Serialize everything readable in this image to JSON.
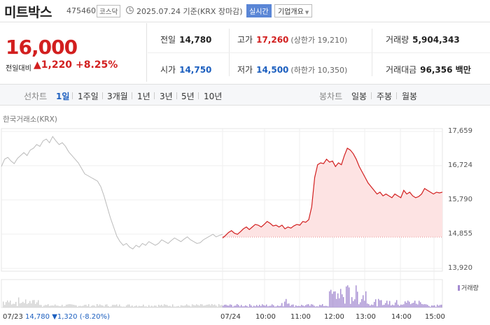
{
  "header": {
    "stock_name": "미트박스",
    "stock_code": "475460",
    "market_badge": "코스닥",
    "basis": "2025.07.24  기준(KRX 장마감)",
    "realtime_button": "실시간",
    "overview_button": "기업개요"
  },
  "price": {
    "current": "16,000",
    "diff_label": "전일대비",
    "diff_value": "▲1,220",
    "diff_percent": "+8.25%"
  },
  "stats": {
    "prev_close": {
      "label": "전일",
      "value": "14,780"
    },
    "high": {
      "label": "고가",
      "value": "17,260",
      "sub": "(상한가 19,210)"
    },
    "volume": {
      "label": "거래량",
      "value": "5,904,343"
    },
    "open": {
      "label": "시가",
      "value": "14,750"
    },
    "low": {
      "label": "저가",
      "value": "14,500",
      "sub": "(하한가 10,350)"
    },
    "trade_value": {
      "label": "거래대금",
      "value": "96,356 백만"
    }
  },
  "tabs": {
    "line_label": "선차트",
    "line_tabs": [
      "1일",
      "1주일",
      "3개월",
      "1년",
      "3년",
      "5년",
      "10년"
    ],
    "active_tab": "1일",
    "candle_label": "봉차트",
    "candle_tabs": [
      "일봉",
      "주봉",
      "월봉"
    ]
  },
  "chart_source": "한국거래소(KRX)",
  "chart_data": {
    "type": "line",
    "y_ticks": [
      "17,659",
      "16,724",
      "15,790",
      "14,855",
      "13,920"
    ],
    "ylim": [
      13920,
      17659
    ],
    "prev_close_line": 14780,
    "x_ticks": [
      "07/24",
      "10:00",
      "11:00",
      "12:00",
      "13:00",
      "14:00",
      "15:00"
    ],
    "prev_day_label": "07/23",
    "prev_day_info": {
      "price": "14,780",
      "change": "▼1,320",
      "percent": "(-8.20%)"
    },
    "volume_legend": "거래량",
    "series": [
      {
        "color": "#bbbbbb",
        "values": [
          16700,
          16900,
          16950,
          16850,
          16780,
          16920,
          17000,
          17080,
          17000,
          17150,
          17200,
          17300,
          17250,
          17400,
          17450,
          17350,
          17520,
          17400,
          17300,
          17350,
          17250,
          17100,
          17000,
          16900,
          16800,
          16650,
          16500,
          16450,
          16400,
          16350,
          16300,
          16150,
          15900,
          15600,
          15300,
          15050,
          14800,
          14650,
          14550,
          14600,
          14500,
          14450,
          14550,
          14500,
          14600,
          14550,
          14650,
          14600,
          14550,
          14600,
          14700,
          14650,
          14600,
          14680,
          14750,
          14700,
          14650,
          14720,
          14780,
          14700,
          14650,
          14600,
          14620,
          14700,
          14750,
          14800,
          14850,
          14780,
          14820,
          14850
        ]
      },
      {
        "color": "#d21f1f",
        "values": [
          14750,
          14820,
          14900,
          14950,
          14880,
          14850,
          14920,
          15000,
          15050,
          14980,
          15050,
          15120,
          15100,
          15050,
          15120,
          15200,
          15150,
          15080,
          15100,
          15050,
          15100,
          15000,
          15050,
          15020,
          15080,
          15120,
          15100,
          15200,
          15180,
          15250,
          15600,
          16400,
          16750,
          16800,
          16780,
          16900,
          16820,
          16850,
          16700,
          16800,
          16750,
          17000,
          17200,
          17150,
          17050,
          16900,
          16700,
          16550,
          16400,
          16250,
          16150,
          16050,
          15950,
          16000,
          15900,
          15950,
          15900,
          15850,
          15950,
          15900,
          15850,
          16050,
          15950,
          16000,
          15900,
          15850,
          15880,
          15950,
          16100,
          16050,
          16000,
          15950,
          16000,
          15980,
          16000
        ]
      }
    ]
  }
}
